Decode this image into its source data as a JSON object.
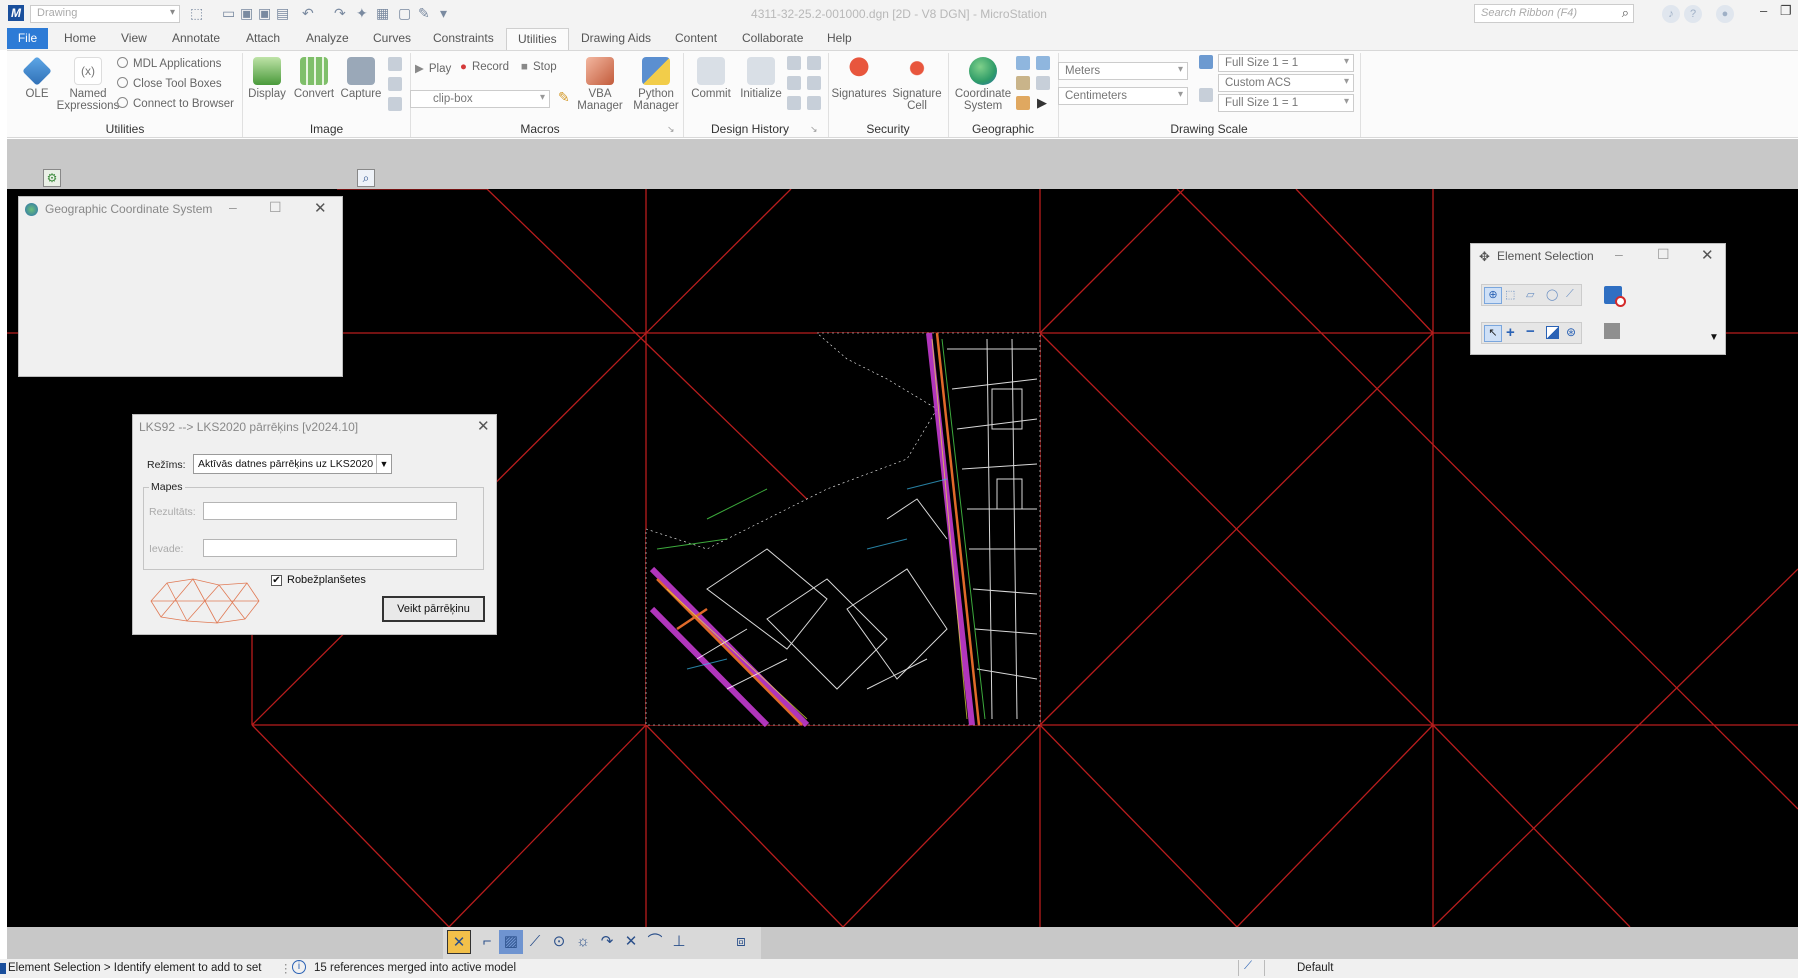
{
  "titlebar": {
    "workspace_combo": "Drawing",
    "doc_title": "4311-32-25.2-001000.dgn [2D - V8 DGN] - MicroStation",
    "search_placeholder": "Search Ribbon (F4)"
  },
  "tabs": {
    "file": "File",
    "items": [
      "Home",
      "View",
      "Annotate",
      "Attach",
      "Analyze",
      "Curves",
      "Constraints",
      "Utilities",
      "Drawing Aids",
      "Content",
      "Collaborate",
      "Help"
    ],
    "active": "Utilities"
  },
  "ribbon": {
    "utilities": {
      "label": "Utilities",
      "ole": "OLE",
      "named_expressions_1": "Named",
      "named_expressions_2": "Expressions",
      "mdl_applications": "MDL Applications",
      "close_tool_boxes": "Close Tool Boxes",
      "connect_to_browser": "Connect to Browser"
    },
    "image": {
      "label": "Image",
      "display": "Display",
      "convert": "Convert",
      "capture": "Capture"
    },
    "macros": {
      "label": "Macros",
      "play": "Play",
      "record": "Record",
      "stop": "Stop",
      "combo": "clip-box",
      "vba_1": "VBA",
      "vba_2": "Manager",
      "python_1": "Python",
      "python_2": "Manager"
    },
    "design_history": {
      "label": "Design History",
      "commit": "Commit",
      "initialize": "Initialize"
    },
    "security": {
      "label": "Security",
      "signatures": "Signatures",
      "signature_cell_1": "Signature",
      "signature_cell_2": "Cell"
    },
    "geographic": {
      "label": "Geographic",
      "coord_1": "Coordinate",
      "coord_2": "System"
    },
    "drawing_scale": {
      "label": "Drawing Scale",
      "units_master": "Meters",
      "units_sub": "Centimeters",
      "scale_1": "Full Size 1 = 1",
      "acs": "Custom ACS",
      "scale_2": "Full Size 1 = 1"
    }
  },
  "gcs_dialog": {
    "title": "Geographic Coordinate System"
  },
  "lks_dialog": {
    "title": "LKS92 --> LKS2020 pārrēķins [v2024.10]",
    "mode_label": "Režīms:",
    "mode_value": "Aktīvās datnes pārrēķins uz LKS2020",
    "folders_group": "Mapes",
    "result_label": "Rezultāts:",
    "input_label": "Ievade:",
    "checkbox_label": "Robežplanšetes",
    "checkbox_checked": true,
    "run_button": "Veikt pārrēķinu"
  },
  "element_selection": {
    "title": "Element Selection"
  },
  "statusbar": {
    "prompt": "Element Selection > Identify element to add to set",
    "message": "15 references merged into active model",
    "level": "Default"
  },
  "colors": {
    "file_tab": "#2d7bd6",
    "canvas": "#000000",
    "grid_lines": "#b81d1d",
    "map_magenta": "#c43bd0",
    "map_orange": "#e06a2a"
  }
}
